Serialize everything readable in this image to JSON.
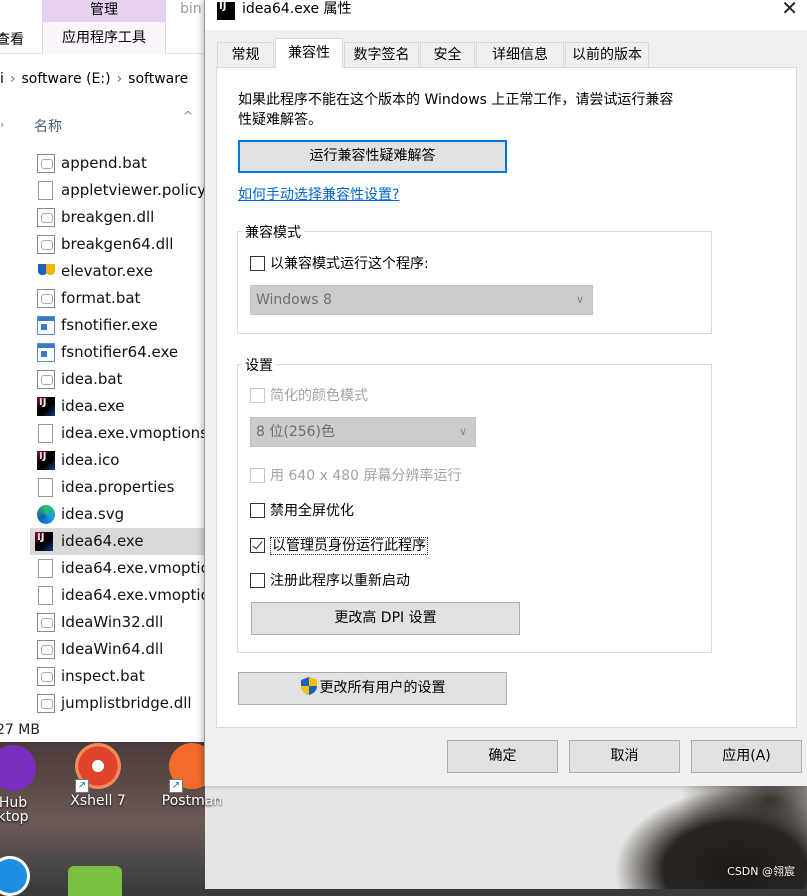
{
  "explorer": {
    "ribbon_manage": "管理",
    "ribbon_bin": "bin",
    "ribbon_view": "查看",
    "ribbon_apptools": "应用程序工具",
    "address": [
      "software (E:)",
      "software"
    ],
    "column_name": "名称",
    "files": [
      {
        "name": "append.bat",
        "icon": "bat-file-icon"
      },
      {
        "name": "appletviewer.policy",
        "icon": "blank-file-icon"
      },
      {
        "name": "breakgen.dll",
        "icon": "dll-file-icon"
      },
      {
        "name": "breakgen64.dll",
        "icon": "dll-file-icon"
      },
      {
        "name": "elevator.exe",
        "icon": "elevator-icon"
      },
      {
        "name": "format.bat",
        "icon": "bat-file-icon"
      },
      {
        "name": "fsnotifier.exe",
        "icon": "exe-window-icon"
      },
      {
        "name": "fsnotifier64.exe",
        "icon": "exe-window-icon"
      },
      {
        "name": "idea.bat",
        "icon": "bat-file-icon"
      },
      {
        "name": "idea.exe",
        "icon": "intellij-icon"
      },
      {
        "name": "idea.exe.vmoptions",
        "icon": "blank-file-icon"
      },
      {
        "name": "idea.ico",
        "icon": "intellij-icon"
      },
      {
        "name": "idea.properties",
        "icon": "blank-file-icon"
      },
      {
        "name": "idea.svg",
        "icon": "edge-icon"
      },
      {
        "name": "idea64.exe",
        "icon": "intellij-icon",
        "selected": true
      },
      {
        "name": "idea64.exe.vmoptio",
        "icon": "blank-file-icon"
      },
      {
        "name": "idea64.exe.vmoptio",
        "icon": "blank-file-icon"
      },
      {
        "name": "IdeaWin32.dll",
        "icon": "dll-file-icon"
      },
      {
        "name": "IdeaWin64.dll",
        "icon": "dll-file-icon"
      },
      {
        "name": "inspect.bat",
        "icon": "bat-file-icon"
      },
      {
        "name": "jumplistbridge.dll",
        "icon": "dll-file-icon"
      }
    ],
    "status_size": "27 MB"
  },
  "desktop": {
    "icons": [
      {
        "label1": "Hub",
        "label2": "ktop",
        "icon": "github-desktop-icon"
      },
      {
        "label1": "Xshell 7",
        "label2": "",
        "icon": "xshell-icon"
      },
      {
        "label1": "Postman",
        "label2": "",
        "icon": "postman-icon"
      }
    ],
    "watermark": "CSDN @翎宸"
  },
  "dialog": {
    "title": "idea64.exe 属性",
    "tabs": [
      "常规",
      "兼容性",
      "数字签名",
      "安全",
      "详细信息",
      "以前的版本"
    ],
    "active_tab": 1,
    "intro_line1": "如果此程序不能在这个版本的 Windows 上正常工作，请尝试运行兼容",
    "intro_line2": "性疑难解答。",
    "run_troubleshooter": "运行兼容性疑难解答",
    "manual_link": "如何手动选择兼容性设置?",
    "compat_group": "兼容模式",
    "compat_checkbox": "以兼容模式运行这个程序:",
    "compat_os": "Windows 8",
    "settings_group": "设置",
    "reduced_color": "简化的颜色模式",
    "color_depth": "8 位(256)色",
    "run_640": "用 640 x 480 屏幕分辨率运行",
    "disable_fullscreen": "禁用全屏优化",
    "run_as_admin": "以管理员身份运行此程序",
    "register_restart": "注册此程序以重新启动",
    "change_dpi": "更改高 DPI 设置",
    "change_all_users": "更改所有用户的设置",
    "ok": "确定",
    "cancel": "取消",
    "apply": "应用(A)"
  }
}
